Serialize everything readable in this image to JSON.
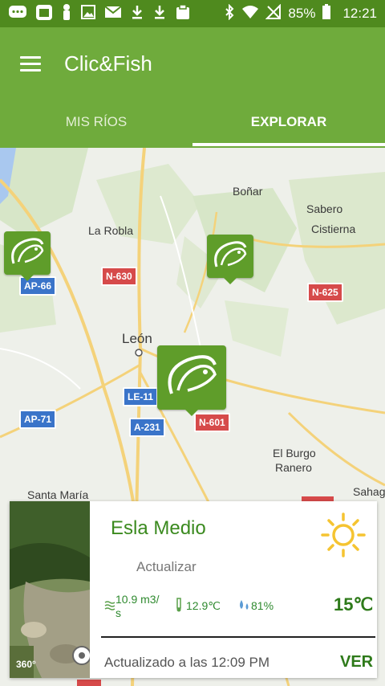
{
  "status_bar": {
    "battery": "85%",
    "time": "12:21",
    "left_icons": [
      "message-icon",
      "calendar-icon",
      "figure-icon",
      "image-icon",
      "mail-icon",
      "download-icon",
      "download-icon",
      "clipboard-icon"
    ],
    "right_icons": [
      "bluetooth-icon",
      "wifi-icon",
      "no-signal-icon",
      "battery-icon"
    ]
  },
  "app_bar": {
    "title": "Clic&Fish",
    "tabs": [
      {
        "label": "MIS RÍOS",
        "active": false
      },
      {
        "label": "EXPLORAR",
        "active": true
      }
    ]
  },
  "map": {
    "towns": [
      "Boñar",
      "Sabero",
      "Cistierna",
      "La Robla",
      "León",
      "El Burgo",
      "Ranero",
      "Santa María",
      "Sahag"
    ],
    "roads": [
      "AP-66",
      "N-630",
      "N-625",
      "LE-11",
      "A-231",
      "N-601",
      "AP-71"
    ],
    "marker_icon": "fish-icon"
  },
  "card": {
    "river_name": "Esla Medio",
    "update_label": "Actualizar",
    "weather_icon": "sun-icon",
    "flow": "10.9 m3/\ns",
    "water_temp": "12.9℃",
    "humidity": "81%",
    "air_temp": "15℃",
    "updated_text": "Actualizado a las 12:09 PM",
    "view_label": "VER",
    "photo_badge": "360°"
  },
  "colors": {
    "status_bar": "#4f8a1e",
    "app_bar": "#6fab3c",
    "marker": "#5f9d2a",
    "accent_text": "#2e7a1a",
    "sun": "#f5c431"
  }
}
